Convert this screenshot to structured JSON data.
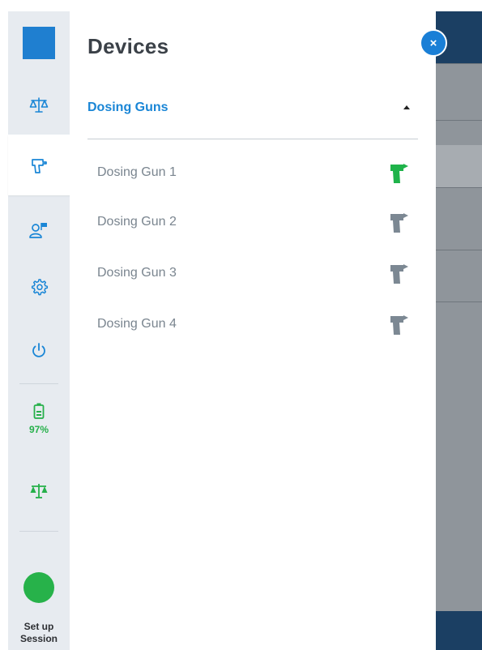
{
  "drawer": {
    "title": "Devices",
    "section": {
      "title": "Dosing Guns",
      "expanded": true
    },
    "devices": [
      {
        "label": "Dosing Gun 1",
        "status_color": "#1fb34a",
        "icon": "dosing-gun-icon"
      },
      {
        "label": "Dosing Gun 2",
        "status_color": "#7c8893",
        "icon": "dosing-gun-icon"
      },
      {
        "label": "Dosing Gun 3",
        "status_color": "#7c8893",
        "icon": "dosing-gun-icon"
      },
      {
        "label": "Dosing Gun 4",
        "status_color": "#7c8893",
        "icon": "dosing-gun-icon"
      }
    ],
    "close_icon": "×"
  },
  "rail": {
    "items": [
      {
        "icon": "app-logo"
      },
      {
        "icon": "scale-icon"
      },
      {
        "icon": "dosing-gun-icon",
        "selected": true
      },
      {
        "icon": "user-flag-icon"
      },
      {
        "icon": "gear-icon"
      },
      {
        "icon": "power-icon"
      }
    ],
    "battery": {
      "icon": "battery-icon",
      "percent": "97%"
    },
    "scale_status_icon": "scale-icon",
    "session": {
      "label_line1": "Set up",
      "label_line2": "Session"
    }
  },
  "colors": {
    "accent_blue": "#1a86d6",
    "active_green": "#1fb34a",
    "inactive_gray": "#7c8893",
    "rail_bg": "#e7ebf0"
  }
}
